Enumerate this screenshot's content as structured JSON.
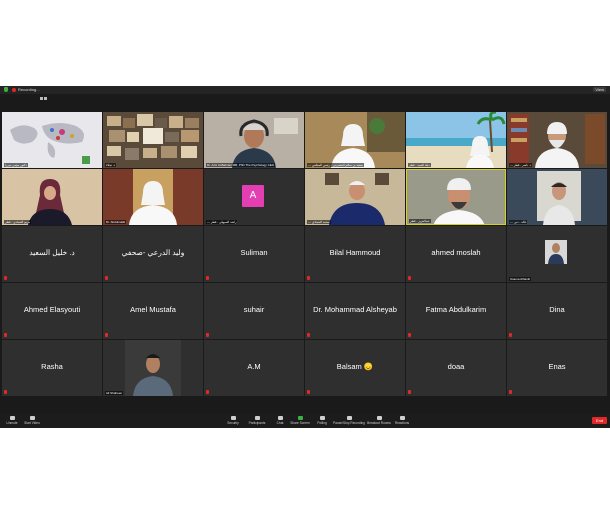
{
  "topbar": {
    "recording_label": "Recording...",
    "view_label": "View"
  },
  "video_tiles": [
    {
      "caption": "دكتور مؤمن ميرزا"
    },
    {
      "caption": "د. نجلاء"
    },
    {
      "caption": "Dr. Aziz Al-Bahrani MB, PhD The Psychology CEO"
    },
    {
      "caption": "— سعيد بن سالم الحضرمي - رئيس المجلس"
    },
    {
      "caption": "ديلة السيد - قطر"
    },
    {
      "caption": "— د. ناصر - قطر"
    },
    {
      "caption": "مريم الحمادي - قطر"
    },
    {
      "caption": "Dr. Abdulmalik"
    },
    {
      "caption": "— راشد السيهلي - قطر",
      "avatar_letter": "A"
    },
    {
      "caption": "— محمد الحمادي"
    },
    {
      "caption": "عبدالعزيز - قطر"
    },
    {
      "caption": "— خالد - دبي"
    }
  ],
  "name_tiles": [
    "د. خليل السعيد",
    "وليد الدرعي -صحفي",
    "Suliman",
    "Bilal Hammoud",
    "ahmed moslah",
    "Ahmed Elasyouti",
    "Amel Mustafa",
    "suhair",
    "Dr. Mohammad Alsheyab",
    "Fatma Abdulkarim",
    "Dina",
    "Rasha",
    "A.M",
    "Balsam 😞",
    "doaa",
    "Enas"
  ],
  "small_video_tiles": [
    {
      "caption": "Usama Alhaniti"
    },
    {
      "caption": "Ali Shaheen"
    }
  ],
  "bottombar": {
    "unmute": "Unmute",
    "start_video": "Start Video",
    "security": "Security",
    "participants": "Participants",
    "chat": "Chat",
    "share_screen": "Share Screen",
    "polling": "Polling",
    "pause_recording": "Pause/Stop Recording",
    "breakout_rooms": "Breakout Rooms",
    "reactions": "Reactions",
    "end": "End"
  },
  "colors": {
    "avatar_a": "#e43fb2",
    "end_button": "#e02828",
    "share_accent": "#3cb043"
  }
}
